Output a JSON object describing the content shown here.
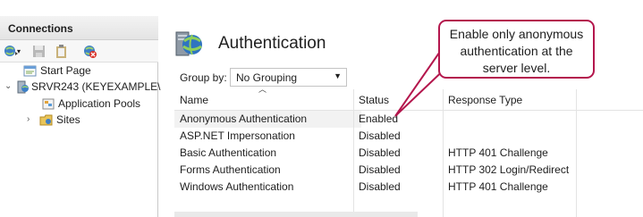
{
  "connections": {
    "title": "Connections",
    "toolbar": [
      {
        "icon": "connect-icon"
      },
      {
        "icon": "save-icon"
      },
      {
        "icon": "clipboard-icon"
      },
      {
        "icon": "disconnect-icon"
      }
    ],
    "tree": [
      {
        "label": "Start Page",
        "icon": "start-page-icon"
      },
      {
        "label": "SRVR243 (KEYEXAMPLE\\",
        "icon": "server-icon",
        "expanded": true
      },
      {
        "label": "Application Pools",
        "icon": "app-pools-icon"
      },
      {
        "label": "Sites",
        "icon": "sites-folder-icon",
        "expanded": false
      }
    ]
  },
  "main": {
    "title": "Authentication",
    "title_icon": "globe-icon",
    "group_by_label": "Group by:",
    "group_by_value": "No Grouping",
    "columns": [
      "Name",
      "Status",
      "Response Type"
    ],
    "rows": [
      {
        "name": "Anonymous Authentication",
        "status": "Enabled",
        "response": ""
      },
      {
        "name": "ASP.NET Impersonation",
        "status": "Disabled",
        "response": ""
      },
      {
        "name": "Basic Authentication",
        "status": "Disabled",
        "response": "HTTP 401 Challenge"
      },
      {
        "name": "Forms Authentication",
        "status": "Disabled",
        "response": "HTTP 302 Login/Redirect"
      },
      {
        "name": "Windows Authentication",
        "status": "Disabled",
        "response": "HTTP 401 Challenge"
      }
    ]
  },
  "callout": {
    "lines": [
      "Enable only anonymous",
      "authentication at the",
      "server level."
    ],
    "color": "#b4174d"
  }
}
